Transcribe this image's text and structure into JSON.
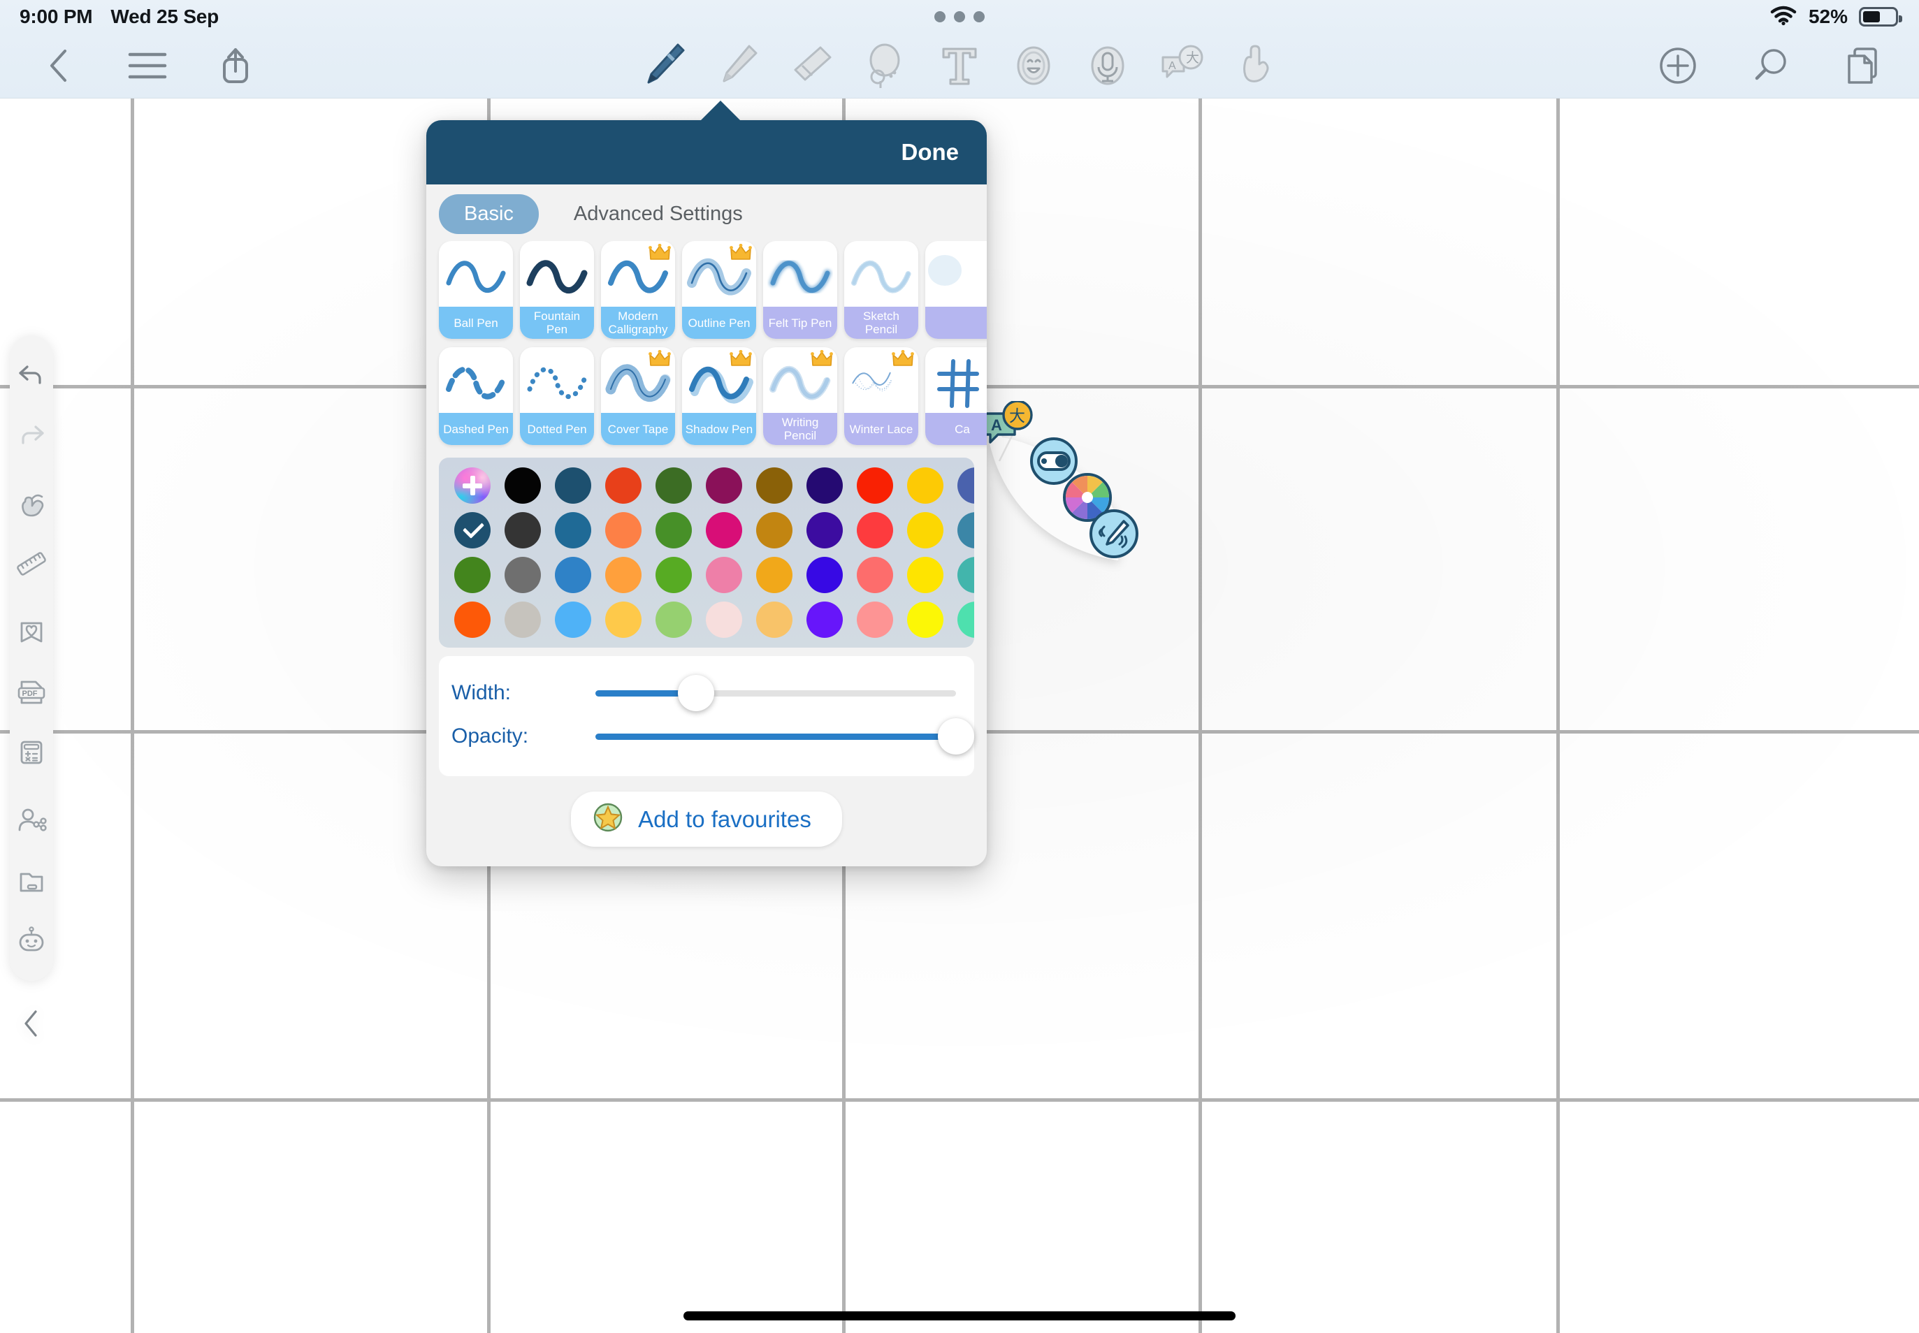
{
  "status_bar": {
    "time": "9:00 PM",
    "date": "Wed 25 Sep",
    "battery_percent": "52%",
    "wifi_icon": "wifi-icon",
    "battery_icon": "battery-icon",
    "multitask_icon": "multitask-dots-icon"
  },
  "toolbar": {
    "left_items": [
      {
        "name": "back-button",
        "icon": "chevron-left-icon"
      },
      {
        "name": "menu-button",
        "icon": "hamburger-menu-icon"
      },
      {
        "name": "share-button",
        "icon": "share-icon"
      }
    ],
    "tools": [
      {
        "name": "pen-tool",
        "icon": "pen-icon",
        "selected": true
      },
      {
        "name": "highlighter-tool",
        "icon": "highlighter-icon",
        "selected": false
      },
      {
        "name": "eraser-tool",
        "icon": "eraser-icon",
        "selected": false
      },
      {
        "name": "lasso-tool",
        "icon": "lasso-icon",
        "selected": false
      },
      {
        "name": "text-tool",
        "icon": "text-t-icon",
        "selected": false
      },
      {
        "name": "sticker-tool",
        "icon": "sticker-face-icon",
        "selected": false
      },
      {
        "name": "audio-tool",
        "icon": "microphone-icon",
        "selected": false
      },
      {
        "name": "translate-tool",
        "icon": "translate-icon",
        "selected": false
      },
      {
        "name": "hand-tool",
        "icon": "hand-icon",
        "selected": false
      }
    ],
    "right_items": [
      {
        "name": "add-button",
        "icon": "plus-circle-icon"
      },
      {
        "name": "search-button",
        "icon": "magnifier-icon"
      },
      {
        "name": "pages-button",
        "icon": "pages-copy-icon"
      }
    ]
  },
  "sidebar": {
    "items": [
      {
        "name": "undo-button",
        "icon": "undo-arrow-icon",
        "disabled": false
      },
      {
        "name": "redo-button",
        "icon": "redo-arrow-icon",
        "disabled": true
      },
      {
        "name": "touch-mode-button",
        "icon": "hand-touch-icon",
        "disabled": false
      },
      {
        "name": "ruler-button",
        "icon": "ruler-icon",
        "disabled": false
      },
      {
        "name": "bookmark-button",
        "icon": "bookmark-heart-icon",
        "disabled": false
      },
      {
        "name": "pdf-button",
        "icon": "pdf-file-icon",
        "disabled": false
      },
      {
        "name": "calculator-button",
        "icon": "calculator-icon",
        "disabled": false
      },
      {
        "name": "share-user-button",
        "icon": "share-user-icon",
        "disabled": false
      },
      {
        "name": "folder-button",
        "icon": "folder-icon",
        "disabled": false
      },
      {
        "name": "ai-assistant-button",
        "icon": "robot-icon",
        "disabled": false
      },
      {
        "name": "collapse-sidebar-button",
        "icon": "chevron-left-icon",
        "disabled": false
      }
    ]
  },
  "pen_popover": {
    "done_label": "Done",
    "header_color": "#1d4f70",
    "tabs": [
      {
        "label": "Basic",
        "active": true
      },
      {
        "label": "Advanced Settings",
        "active": false
      }
    ],
    "pens": [
      [
        {
          "label": "Ball Pen",
          "style": "solid",
          "premium": false,
          "tier": "blue"
        },
        {
          "label": "Fountain Pen",
          "style": "fountain",
          "premium": false,
          "tier": "blue"
        },
        {
          "label": "Modern Calligraphy",
          "style": "calligraphy",
          "premium": true,
          "tier": "blue"
        },
        {
          "label": "Outline Pen",
          "style": "outline",
          "premium": true,
          "tier": "blue"
        },
        {
          "label": "Felt Tip Pen",
          "style": "felt",
          "premium": false,
          "tier": "purple"
        },
        {
          "label": "Sketch Pencil",
          "style": "sketch",
          "premium": false,
          "tier": "purple"
        },
        {
          "label": "",
          "style": "partial",
          "premium": false,
          "tier": "purple"
        }
      ],
      [
        {
          "label": "Dashed Pen",
          "style": "dashed",
          "premium": false,
          "tier": "blue"
        },
        {
          "label": "Dotted Pen",
          "style": "dotted",
          "premium": false,
          "tier": "blue"
        },
        {
          "label": "Cover Tape",
          "style": "tape",
          "premium": true,
          "tier": "blue"
        },
        {
          "label": "Shadow Pen",
          "style": "shadow",
          "premium": true,
          "tier": "blue"
        },
        {
          "label": "Writing Pencil",
          "style": "writing",
          "premium": true,
          "tier": "purple"
        },
        {
          "label": "Winter Lace",
          "style": "lace",
          "premium": true,
          "tier": "purple"
        },
        {
          "label": "Ca",
          "style": "cjk",
          "premium": false,
          "tier": "purple"
        }
      ]
    ],
    "palette": {
      "add_color_label": "add-color",
      "selected": {
        "row": 1,
        "col": 0,
        "color": "#1e506f"
      },
      "rows": [
        [
          "ADD",
          "#040404",
          "#1d506f",
          "#e8401a",
          "#3c6d24",
          "#8a1159",
          "#8a6108",
          "#250a72",
          "#f92103",
          "#fdca05",
          "#4a62ad",
          "#f76ab8",
          "#ed6425"
        ],
        [
          "#1e506f",
          "#343434",
          "#1f6a96",
          "#fd8046",
          "#479028",
          "#d80e77",
          "#c28511",
          "#3c0ca0",
          "#fd3b3e",
          "#fcd702",
          "#3b86a7",
          "#c752cf",
          "#f3833f"
        ],
        [
          "#43851d",
          "#6f6f6f",
          "#2f82c7",
          "#ffa03c",
          "#57ab23",
          "#ee7fa8",
          "#f1a81a",
          "#3709e4",
          "#fd6d6c",
          "#fee400",
          "#42b5ac",
          "#a44ee2",
          "#f4955a"
        ],
        [
          "#fd5908",
          "#c6c3bd",
          "#4fb2f7",
          "#fec94a",
          "#96d070",
          "#f7dedd",
          "#f8c369",
          "#6716fa",
          "#fd9494",
          "#fcf706",
          "#4ee0ae",
          "#8040f4",
          "#f7ab72"
        ]
      ]
    },
    "sliders": [
      {
        "label": "Width:",
        "name": "width-slider",
        "value": 28
      },
      {
        "label": "Opacity:",
        "name": "opacity-slider",
        "value": 100
      }
    ],
    "favourites_button": {
      "label": "Add to favourites",
      "icon": "star-badge-icon"
    }
  },
  "arc_widget": {
    "buttons": [
      {
        "name": "translate-badge-icon",
        "icon": "translate-badge-icon"
      },
      {
        "name": "eraser-toggle-icon",
        "icon": "eraser-toggle-icon"
      },
      {
        "name": "color-wheel-icon",
        "icon": "color-wheel-icon"
      },
      {
        "name": "pen-stroke-icon",
        "icon": "pen-stroke-icon"
      }
    ]
  },
  "canvas": {
    "grid": {
      "line_color": "#b2b2b2",
      "vertical_x": [
        187,
        697,
        1205,
        1715,
        2227
      ],
      "horizontal_y": [
        411,
        905,
        1432
      ]
    }
  }
}
